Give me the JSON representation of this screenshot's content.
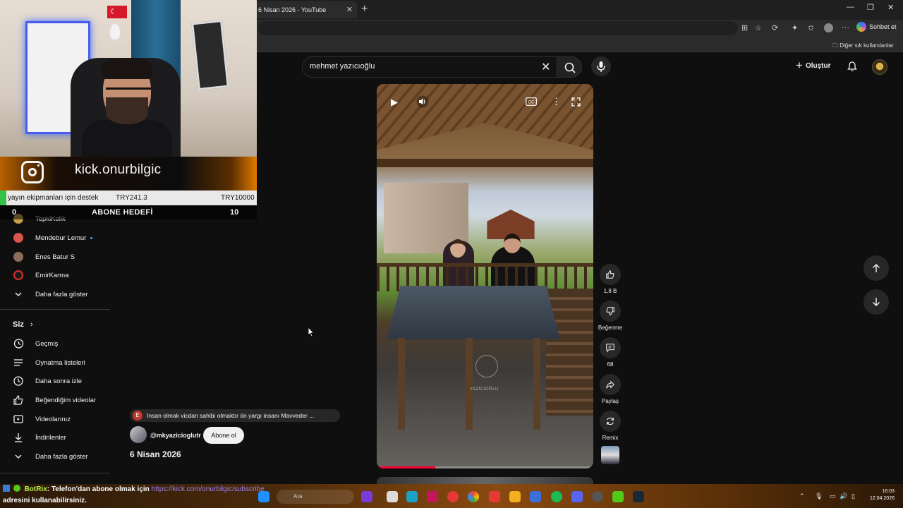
{
  "browser": {
    "tab_title": "6 Nisan 2026 - YouTube",
    "tab_close": "✕",
    "new_tab": "+",
    "chat_button": "Sohbet et",
    "other_bookmarks": "Diğer sık kullanılanlar"
  },
  "header": {
    "search_value": "mehmet yazıcıoğlu",
    "create_label": "Oluştur"
  },
  "sidebar": {
    "channels": [
      {
        "name": "TepkiKolik",
        "color": "#c9a24b"
      },
      {
        "name": "Mendebur Lemur",
        "color": "#d9534f",
        "live": true
      },
      {
        "name": "Enes Batur S",
        "color": "#8a6d5a"
      },
      {
        "name": "EmirKarma",
        "color": "#e02d2d"
      }
    ],
    "show_more_1": "Daha fazla göster",
    "you_header": "Siz",
    "you_items": [
      {
        "label": "Geçmiş",
        "icon": "history-icon"
      },
      {
        "label": "Oynatma listeleri",
        "icon": "playlists-icon"
      },
      {
        "label": "Daha sonra izle",
        "icon": "watch-later-icon"
      },
      {
        "label": "Beğendiğim videolar",
        "icon": "like-icon"
      },
      {
        "label": "Videolarınız",
        "icon": "your-videos-icon"
      },
      {
        "label": "İndirilenler",
        "icon": "download-icon"
      }
    ],
    "show_more_2": "Daha fazla göster"
  },
  "overlay": {
    "insta_handle": "kick.onurbilgic",
    "goal_title": "yayın ekipmanları için destek",
    "goal_current": "TRY241.3",
    "goal_target": "TRY10000",
    "goal_progress": 0.024,
    "sub_current": "0",
    "sub_label": "ABONE HEDEFİ",
    "sub_target": "10"
  },
  "short": {
    "like_count": "1,8 B",
    "dislike_label": "Beğenme",
    "comment_count": "68",
    "share_label": "Paylaş",
    "remix_label": "Remix",
    "comment_initial": "E",
    "top_comment": "İnsan olmak vicdan sahibi olmaktır  ön yargı insanı Mavveder ...",
    "channel_handle": "@mkyazicioglutr",
    "subscribe_label": "Abone ol",
    "date": "6 Nisan 2026",
    "watermark": "YAZICIOĞLU",
    "progress": 0.27
  },
  "chat": {
    "user": "BotRix",
    "message": ": Telefon'dan abone olmak için ",
    "link": "https://kick.com/onurbilgic/subscribe",
    "line2": "adresini kullanabilirsiniz."
  },
  "taskbar": {
    "search_placeholder": "Ara",
    "time": "16:03",
    "date": "12.04.2026"
  }
}
